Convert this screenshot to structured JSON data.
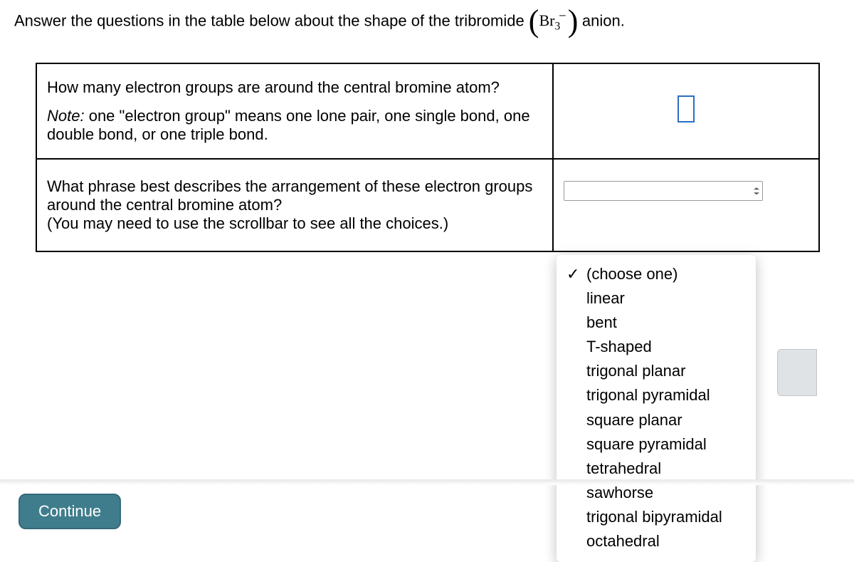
{
  "prompt": {
    "before": "Answer the questions in the table below about the shape of the tribromide ",
    "formula_base": "Br",
    "formula_sub": "3",
    "formula_sup": "−",
    "after": " anion."
  },
  "row1": {
    "question": "How many electron groups are around the central bromine atom?",
    "note_label": "Note:",
    "note_body": " one \"electron group\" means one lone pair, one single bond, one double bond, or one triple bond.",
    "input_value": ""
  },
  "row2": {
    "question": "What phrase best describes the arrangement of these electron groups around the central bromine atom?",
    "hint": "(You may need to use the scrollbar to see all the choices.)"
  },
  "dropdown": {
    "selected": "(choose one)",
    "options": [
      "linear",
      "bent",
      "T-shaped",
      "trigonal planar",
      "trigonal pyramidal",
      "square planar",
      "square pyramidal",
      "tetrahedral",
      "sawhorse",
      "trigonal bipyramidal",
      "octahedral"
    ]
  },
  "continue_label": "Continue"
}
